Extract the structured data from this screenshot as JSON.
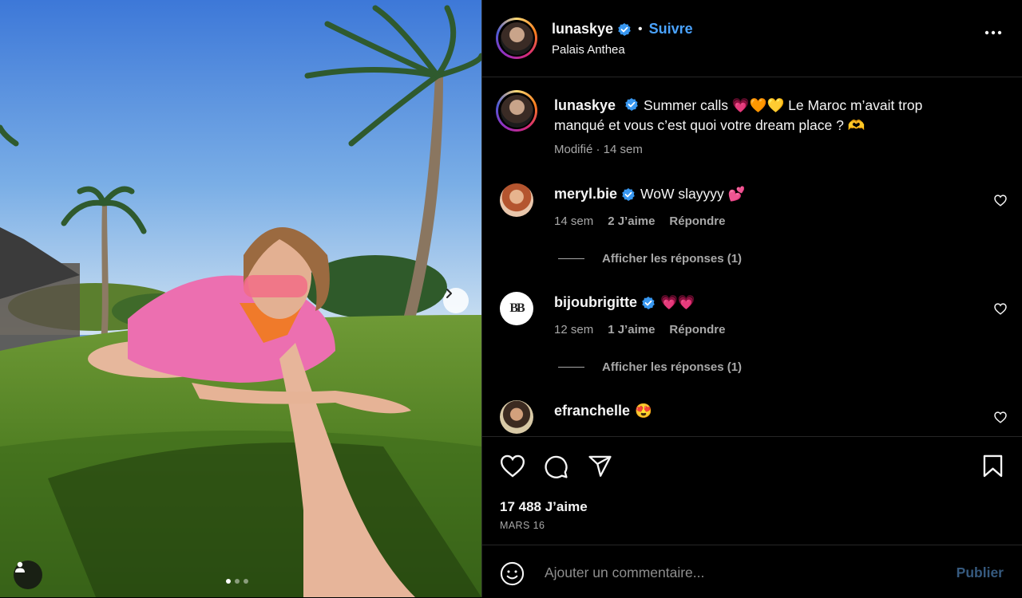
{
  "post": {
    "author": "lunaskye",
    "follow_label": "Suivre",
    "separator": "•",
    "location": "Palais Anthea",
    "caption_text": "Summer calls 💗🧡💛 Le Maroc m’avait trop manqué et vous c’est quoi votre dream place ? 🫶",
    "caption_meta": "Modifié · 14 sem"
  },
  "comments": [
    {
      "user": "meryl.bie",
      "verified": true,
      "text": "WoW slayyyy 💕",
      "age": "14 sem",
      "likes": "2 J’aime",
      "reply_label": "Répondre",
      "view_replies": "Afficher les réponses (1)"
    },
    {
      "user": "bijoubrigitte",
      "verified": true,
      "text": "💗💗",
      "age": "12 sem",
      "likes": "1 J’aime",
      "reply_label": "Répondre",
      "view_replies": "Afficher les réponses (1)"
    },
    {
      "user": "efranchelle",
      "verified": false,
      "text": "😍"
    }
  ],
  "stats": {
    "likes": "17 488 J’aime",
    "date": "MARS 16"
  },
  "composer": {
    "placeholder": "Ajouter un commentaire...",
    "publish_label": "Publier"
  },
  "carousel": {
    "slide_count": 3,
    "active_index": 0
  },
  "colors": {
    "accent": "#4aa3ff",
    "verified": "#3897f0",
    "muted": "#a8a8a8",
    "publish_disabled": "#365a7f",
    "background": "#000000"
  },
  "icons": [
    "verified-badge-icon",
    "more-options-icon",
    "heart-icon",
    "comment-icon",
    "share-icon",
    "bookmark-icon",
    "emoji-icon",
    "chevron-right-icon",
    "user-tag-icon"
  ]
}
